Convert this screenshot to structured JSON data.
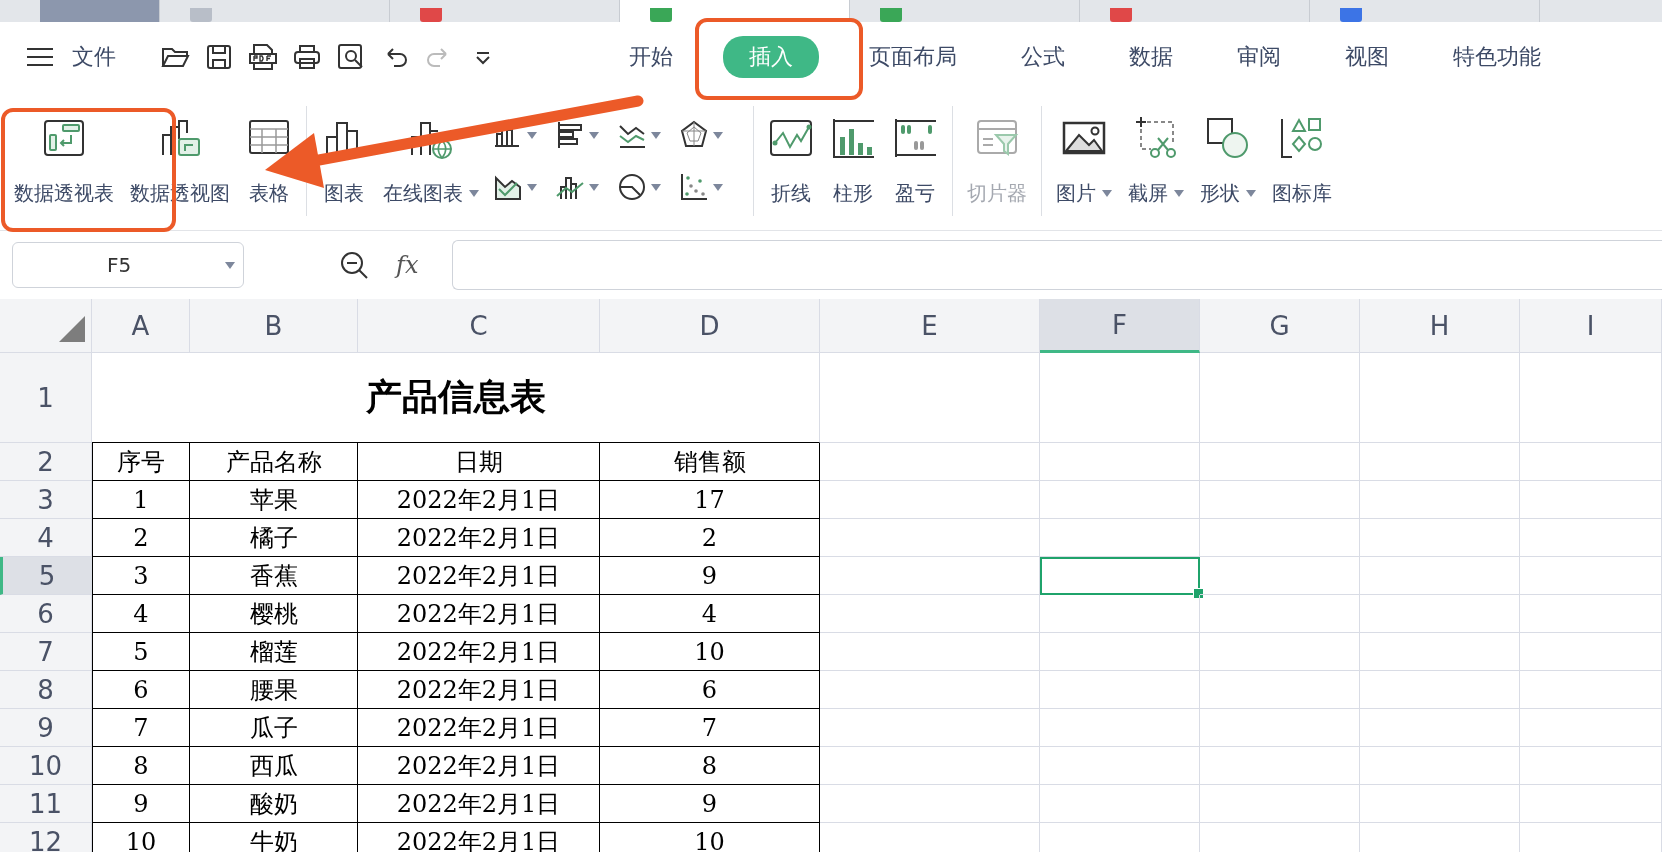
{
  "document_tabs": [
    {
      "kind": "home",
      "selected": false
    },
    {
      "kind": "doc",
      "selected": false
    },
    {
      "kind": "pdf",
      "selected": false
    },
    {
      "kind": "sheet",
      "selected": true
    },
    {
      "kind": "sheet",
      "selected": false
    },
    {
      "kind": "pdf",
      "selected": false
    },
    {
      "kind": "word",
      "selected": false
    }
  ],
  "menu": {
    "file_label": "文件"
  },
  "ribbon_tabs": [
    {
      "label": "开始",
      "selected": false
    },
    {
      "label": "插入",
      "selected": true
    },
    {
      "label": "页面布局",
      "selected": false
    },
    {
      "label": "公式",
      "selected": false
    },
    {
      "label": "数据",
      "selected": false
    },
    {
      "label": "审阅",
      "selected": false
    },
    {
      "label": "视图",
      "selected": false
    },
    {
      "label": "特色功能",
      "selected": false
    }
  ],
  "toolbar": {
    "groups": [
      [
        {
          "kind": "large",
          "label": "数据透视表"
        },
        {
          "kind": "large",
          "label": "数据透视图"
        },
        {
          "kind": "large",
          "label": "表格"
        }
      ],
      [
        {
          "kind": "large",
          "label": "图表"
        },
        {
          "kind": "large",
          "label": "在线图表",
          "dropdown": true
        },
        {
          "kind": "chart-grid"
        }
      ],
      [
        {
          "kind": "large",
          "label": "折线"
        },
        {
          "kind": "large",
          "label": "柱形"
        },
        {
          "kind": "large",
          "label": "盈亏"
        }
      ],
      [
        {
          "kind": "large",
          "label": "切片器",
          "disabled": true
        }
      ],
      [
        {
          "kind": "large",
          "label": "图片",
          "dropdown": true
        },
        {
          "kind": "large",
          "label": "截屏",
          "dropdown": true
        },
        {
          "kind": "large",
          "label": "形状",
          "dropdown": true
        },
        {
          "kind": "large",
          "label": "图标库"
        }
      ]
    ]
  },
  "formula_bar": {
    "name_box": "F5",
    "fx_label": "fx"
  },
  "sheet": {
    "columns": [
      {
        "label": "A",
        "selected": false
      },
      {
        "label": "B",
        "selected": false
      },
      {
        "label": "C",
        "selected": false
      },
      {
        "label": "D",
        "selected": false
      },
      {
        "label": "E",
        "selected": false
      },
      {
        "label": "F",
        "selected": true
      },
      {
        "label": "G",
        "selected": false
      },
      {
        "label": "H",
        "selected": false
      },
      {
        "label": "I",
        "selected": false
      }
    ],
    "rows": [
      {
        "header": "1",
        "selected": false,
        "title": "产品信息表"
      },
      {
        "header": "2",
        "selected": false,
        "cells": [
          "序号",
          "产品名称",
          "日期",
          "销售额"
        ]
      },
      {
        "header": "3",
        "selected": false,
        "cells": [
          "1",
          "苹果",
          "2022年2月1日",
          "17"
        ]
      },
      {
        "header": "4",
        "selected": false,
        "cells": [
          "2",
          "橘子",
          "2022年2月1日",
          "2"
        ]
      },
      {
        "header": "5",
        "selected": true,
        "cells": [
          "3",
          "香蕉",
          "2022年2月1日",
          "9"
        ]
      },
      {
        "header": "6",
        "selected": false,
        "cells": [
          "4",
          "樱桃",
          "2022年2月1日",
          "4"
        ]
      },
      {
        "header": "7",
        "selected": false,
        "cells": [
          "5",
          "榴莲",
          "2022年2月1日",
          "10"
        ]
      },
      {
        "header": "8",
        "selected": false,
        "cells": [
          "6",
          "腰果",
          "2022年2月1日",
          "6"
        ]
      },
      {
        "header": "9",
        "selected": false,
        "cells": [
          "7",
          "瓜子",
          "2022年2月1日",
          "7"
        ]
      },
      {
        "header": "10",
        "selected": false,
        "cells": [
          "8",
          "西瓜",
          "2022年2月1日",
          "8"
        ]
      },
      {
        "header": "11",
        "selected": false,
        "cells": [
          "9",
          "酸奶",
          "2022年2月1日",
          "9"
        ]
      },
      {
        "header": "12",
        "selected": false,
        "cells": [
          "10",
          "牛奶",
          "2022年2月1日",
          "10"
        ]
      }
    ]
  }
}
